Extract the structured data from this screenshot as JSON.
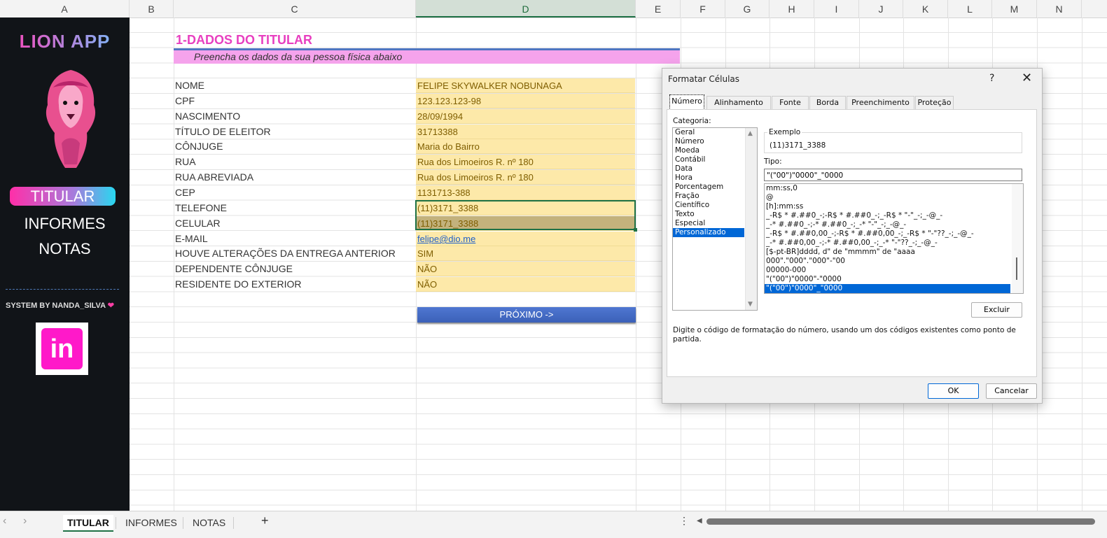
{
  "columns": [
    "A",
    "B",
    "C",
    "D",
    "E",
    "F",
    "G",
    "H",
    "I",
    "J",
    "K",
    "L",
    "M",
    "N"
  ],
  "sidebar": {
    "app_title": "LION APP",
    "nav": [
      "TITULAR",
      "INFORMES",
      "NOTAS"
    ],
    "system_by": "SYSTEM BY NANDA_SILVA",
    "linkedin": "in"
  },
  "sheet": {
    "title": "1-DADOS DO TITULAR",
    "subtitle": "Preencha os dados da sua pessoa física abaixo",
    "rows": [
      {
        "label": "NOME",
        "value": "FELIPE SKYWALKER NOBUNAGA"
      },
      {
        "label": "CPF",
        "value": "123.123.123-98"
      },
      {
        "label": "NASCIMENTO",
        "value": "28/09/1994"
      },
      {
        "label": "TÍTULO DE ELEITOR",
        "value": "31713388"
      },
      {
        "label": "CÔNJUGE",
        "value": "Maria do Bairro"
      },
      {
        "label": "RUA",
        "value": "Rua dos Limoeiros R. nº 180"
      },
      {
        "label": "RUA ABREVIADA",
        "value": "Rua dos Limoeiros R. nº 180"
      },
      {
        "label": "CEP",
        "value": "1131713-388"
      },
      {
        "label": "TELEFONE",
        "value": "(11)3171_3388"
      },
      {
        "label": "CELULAR",
        "value": "(11)3171_3388"
      },
      {
        "label": "E-MAIL",
        "value": "felipe@dio.me"
      },
      {
        "label": "HOUVE ALTERAÇÕES DA ENTREGA ANTERIOR",
        "value": "SIM"
      },
      {
        "label": "DEPENDENTE CÔNJUGE",
        "value": "NÃO"
      },
      {
        "label": "RESIDENTE DO EXTERIOR",
        "value": "NÃO"
      }
    ],
    "next_button": "PRÓXIMO ->"
  },
  "dialog": {
    "title": "Formatar Células",
    "help": "?",
    "close": "✕",
    "tabs": [
      "Número",
      "Alinhamento",
      "Fonte",
      "Borda",
      "Preenchimento",
      "Proteção"
    ],
    "categoria_label": "Categoria:",
    "categories": [
      "Geral",
      "Número",
      "Moeda",
      "Contábil",
      "Data",
      "Hora",
      "Porcentagem",
      "Fração",
      "Científico",
      "Texto",
      "Especial",
      "Personalizado"
    ],
    "exemplo_label": "Exemplo",
    "exemplo_value": "(11)3171_3388",
    "tipo_label": "Tipo:",
    "tipo_value": "\"(\"00\")\"0000\"_\"0000",
    "tipo_list": [
      "mm:ss,0",
      "@",
      "[h]:mm:ss",
      "_-R$ * #.##0_-;-R$ * #.##0_-;_-R$ * \"-\"_-;_-@_-",
      "_-* #.##0_-;-* #.##0_-;_-* \"-\"_-;_-@_-",
      "_-R$ * #.##0,00_-;-R$ * #.##0,00_-;_-R$ * \"-\"??_-;_-@_-",
      "_-* #.##0,00_-;-* #.##0,00_-;_-* \"-\"??_-;_-@_-",
      "[$-pt-BR]dddd, d\" de \"mmmm\" de \"aaaa",
      "000\".\"000\".\"000\"-\"00",
      "00000-000",
      "\"(\"00\")\"0000\"-\"0000",
      "\"(\"00\")\"0000\"_\"0000"
    ],
    "excluir": "Excluir",
    "hint": "Digite o código de formatação do número, usando um dos códigos existentes como ponto de partida.",
    "ok": "OK",
    "cancel": "Cancelar"
  },
  "sheet_tabs": [
    "TITULAR",
    "INFORMES",
    "NOTAS"
  ],
  "colors": {
    "accent_pink": "#e83fc0",
    "selection": "#0067d6",
    "excel_green": "#1e7145",
    "value_fill": "#fde9a9"
  }
}
